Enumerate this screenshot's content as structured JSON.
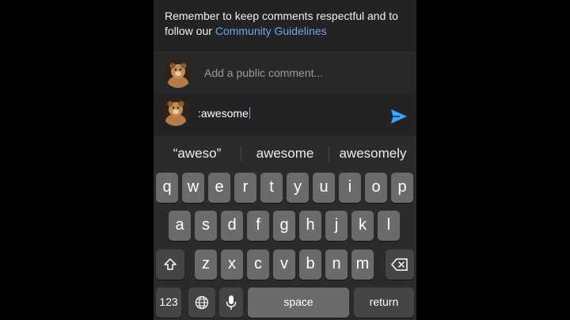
{
  "notice": {
    "text": "Remember to keep comments respectful and to follow our ",
    "link": "Community Guidelines"
  },
  "comment_box": {
    "placeholder": "Add a public comment..."
  },
  "reply": {
    "text": ":awesome"
  },
  "suggestions": [
    "“aweso”",
    "awesome",
    "awesomely"
  ],
  "keyboard": {
    "row1": [
      "q",
      "w",
      "e",
      "r",
      "t",
      "y",
      "u",
      "i",
      "o",
      "p"
    ],
    "row2": [
      "a",
      "s",
      "d",
      "f",
      "g",
      "h",
      "j",
      "k",
      "l"
    ],
    "row3": [
      "z",
      "x",
      "c",
      "v",
      "b",
      "n",
      "m"
    ],
    "numbers": "123",
    "space": "space",
    "return": "return",
    "icons": [
      "shift-icon",
      "backspace-icon",
      "globe-icon",
      "microphone-icon",
      "send-icon"
    ]
  },
  "colors": {
    "link": "#6fa7e6",
    "send": "#3ea6ff",
    "key": "#6b6b6d",
    "key_dark": "#454547"
  }
}
